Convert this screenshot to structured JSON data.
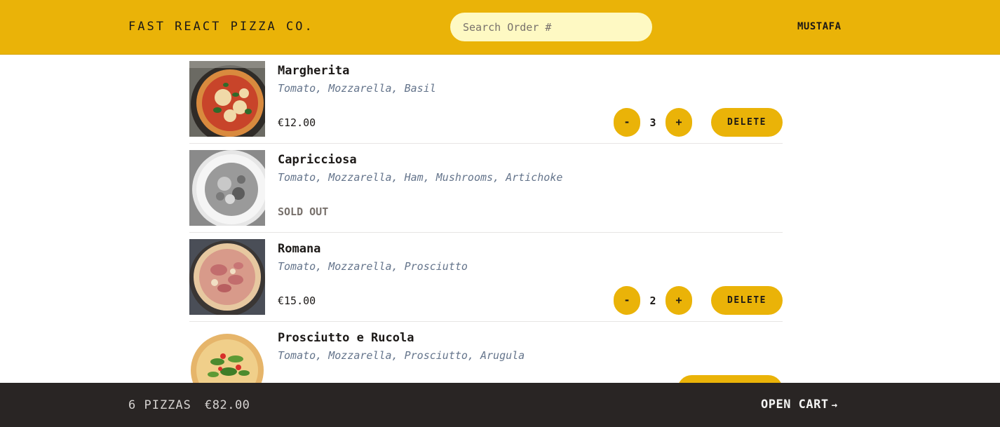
{
  "header": {
    "logo": "FAST REACT PIZZA CO.",
    "search_placeholder": "Search Order #",
    "username": "MUSTAFA"
  },
  "menu": [
    {
      "name": "Margherita",
      "ingredients": "Tomato, Mozzarella, Basil",
      "price": "€12.00",
      "sold_out": false,
      "quantity": "3",
      "decrease_label": "-",
      "increase_label": "+",
      "delete_label": "DELETE"
    },
    {
      "name": "Capricciosa",
      "ingredients": "Tomato, Mozzarella, Ham, Mushrooms, Artichoke",
      "sold_out_label": "SOLD OUT",
      "sold_out": true
    },
    {
      "name": "Romana",
      "ingredients": "Tomato, Mozzarella, Prosciutto",
      "price": "€15.00",
      "sold_out": false,
      "quantity": "2",
      "decrease_label": "-",
      "increase_label": "+",
      "delete_label": "DELETE"
    },
    {
      "name": "Prosciutto e Rucola",
      "ingredients": "Tomato, Mozzarella, Prosciutto, Arugula",
      "sold_out": false
    }
  ],
  "cart_overview": {
    "count": "6 PIZZAS",
    "total": "€82.00",
    "open_cart_label": "OPEN CART",
    "arrow": "→"
  },
  "colors": {
    "primary": "#eab308",
    "search_bg": "#fef9c3",
    "footer_bg": "#292524",
    "ingredients_text": "#64748b"
  }
}
